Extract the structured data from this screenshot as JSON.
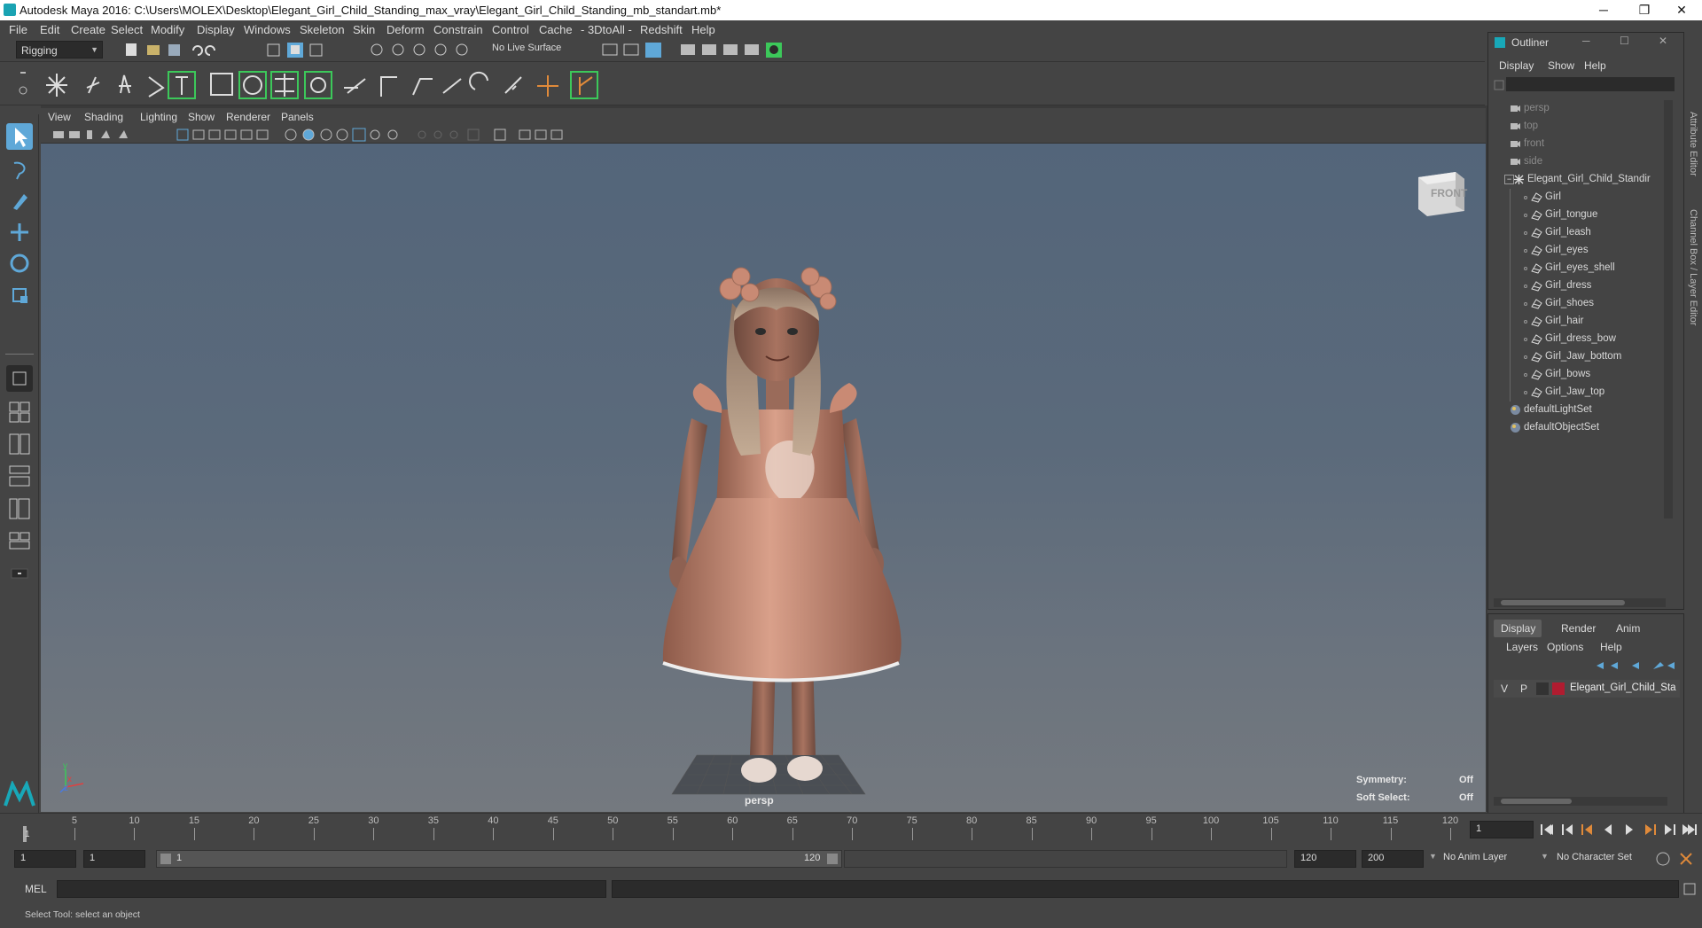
{
  "window": {
    "title": "Autodesk Maya 2016: C:\\Users\\MOLEX\\Desktop\\Elegant_Girl_Child_Standing_max_vray\\Elegant_Girl_Child_Standing_mb_standart.mb*",
    "minimize": "─",
    "restore": "❐",
    "close": "✕"
  },
  "menubar": [
    "File",
    "Edit",
    "Create",
    "Select",
    "Modify",
    "Display",
    "Windows",
    "Skeleton",
    "Skin",
    "Deform",
    "Constrain",
    "Control",
    "Cache",
    "- 3DtoAll -",
    "Redshift",
    "Help"
  ],
  "statusline": {
    "mode": "Rigging",
    "live_surface": "No Live Surface"
  },
  "panel": {
    "menus": [
      "View",
      "Shading",
      "Lighting",
      "Show",
      "Renderer",
      "Panels"
    ]
  },
  "viewport": {
    "camera_label": "persp",
    "viewcube_label": "FRONT",
    "symmetry_label": "Symmetry:",
    "symmetry_value": "Off",
    "soft_select_label": "Soft Select:",
    "soft_select_value": "Off",
    "axis_x": "x",
    "axis_y": "y",
    "axis_z": "z"
  },
  "outliner": {
    "title": "Outliner",
    "menus": [
      "Display",
      "Show",
      "Help"
    ],
    "items": [
      {
        "label": "persp",
        "type": "camera",
        "dim": true
      },
      {
        "label": "top",
        "type": "camera",
        "dim": true
      },
      {
        "label": "front",
        "type": "camera",
        "dim": true
      },
      {
        "label": "side",
        "type": "camera",
        "dim": true
      },
      {
        "label": "Elegant_Girl_Child_Standir",
        "type": "group",
        "dim": false
      },
      {
        "label": "Girl",
        "type": "mesh",
        "dim": false
      },
      {
        "label": "Girl_tongue",
        "type": "mesh",
        "dim": false
      },
      {
        "label": "Girl_leash",
        "type": "mesh",
        "dim": false
      },
      {
        "label": "Girl_eyes",
        "type": "mesh",
        "dim": false
      },
      {
        "label": "Girl_eyes_shell",
        "type": "mesh",
        "dim": false
      },
      {
        "label": "Girl_dress",
        "type": "mesh",
        "dim": false
      },
      {
        "label": "Girl_shoes",
        "type": "mesh",
        "dim": false
      },
      {
        "label": "Girl_hair",
        "type": "mesh",
        "dim": false
      },
      {
        "label": "Girl_dress_bow",
        "type": "mesh",
        "dim": false
      },
      {
        "label": "Girl_Jaw_bottom",
        "type": "mesh",
        "dim": false
      },
      {
        "label": "Girl_bows",
        "type": "mesh",
        "dim": false
      },
      {
        "label": "Girl_Jaw_top",
        "type": "mesh",
        "dim": false
      },
      {
        "label": "defaultLightSet",
        "type": "set",
        "dim": false
      },
      {
        "label": "defaultObjectSet",
        "type": "set",
        "dim": false
      }
    ]
  },
  "side_tabs": {
    "attribute_editor": "Attribute Editor",
    "channel_box": "Channel Box / Layer Editor"
  },
  "layers": {
    "tabs": [
      "Display",
      "Render",
      "Anim"
    ],
    "menus": [
      "Layers",
      "Options",
      "Help"
    ],
    "layer_v": "V",
    "layer_p": "P",
    "layer_name": "Elegant_Girl_Child_Sta",
    "layer_color": "#b01c30"
  },
  "timeline": {
    "ticks": [
      "5",
      "10",
      "15",
      "20",
      "25",
      "30",
      "35",
      "40",
      "45",
      "50",
      "55",
      "60",
      "65",
      "70",
      "75",
      "80",
      "85",
      "90",
      "95",
      "100",
      "105",
      "110",
      "115",
      "120"
    ],
    "start_marker": "1",
    "current_frame": "1"
  },
  "range": {
    "start": "1",
    "playback_start": "1",
    "slider_start": "1",
    "slider_end": "120",
    "playback_end": "120",
    "end": "200",
    "anim_layer": "No Anim Layer",
    "character_set": "No Character Set"
  },
  "cmdline": {
    "label": "MEL"
  },
  "helpline": {
    "text": "Select Tool: select an object"
  },
  "colors": {
    "accent_teal": "#18a8b8",
    "accent_blue": "#5fa8d8",
    "accent_green": "#3cc85a",
    "dress": "#c98a74"
  }
}
